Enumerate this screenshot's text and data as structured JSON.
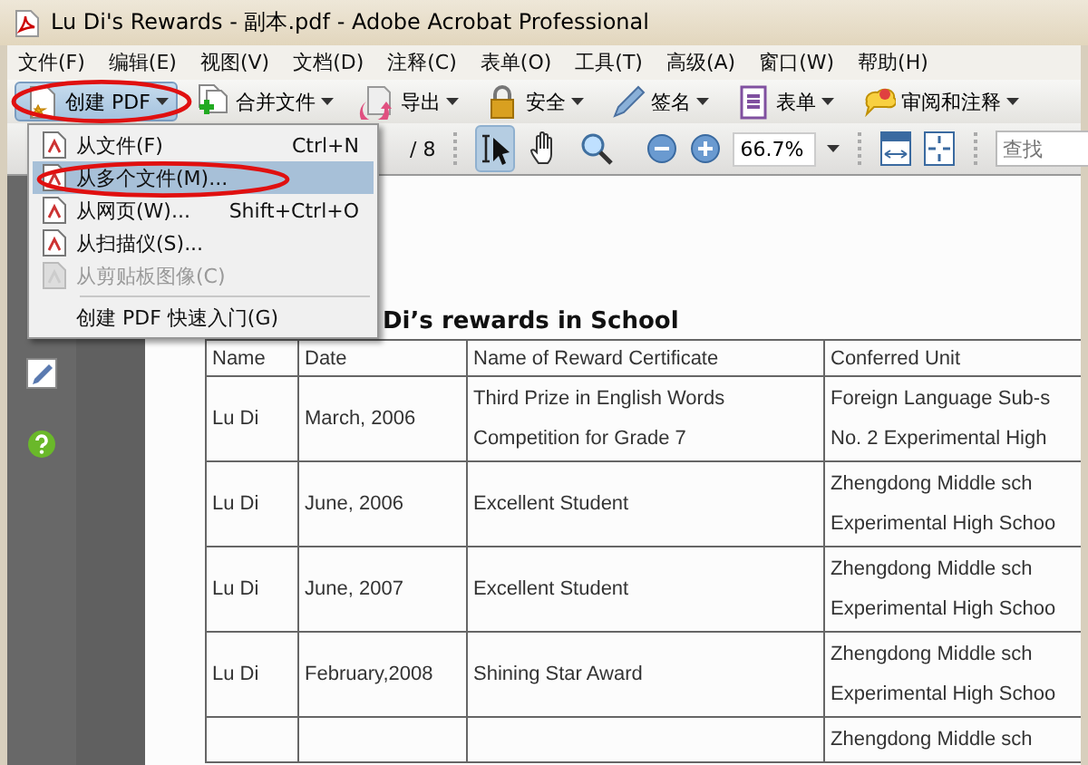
{
  "window": {
    "title": "Lu Di's Rewards - 副本.pdf - Adobe Acrobat Professional"
  },
  "menu_bar": [
    "文件(F)",
    "编辑(E)",
    "视图(V)",
    "文档(D)",
    "注释(C)",
    "表单(O)",
    "工具(T)",
    "高级(A)",
    "窗口(W)",
    "帮助(H)"
  ],
  "toolbar": [
    {
      "label": "创建 PDF",
      "selected": true
    },
    {
      "label": "合并文件",
      "selected": false
    },
    {
      "label": "导出",
      "selected": false
    },
    {
      "label": "安全",
      "selected": false
    },
    {
      "label": "签名",
      "selected": false
    },
    {
      "label": "表单",
      "selected": false
    },
    {
      "label": "审阅和注释",
      "selected": false
    }
  ],
  "nav_toolbar": {
    "page_total": "/ 8",
    "tools": [
      {
        "selected": true
      },
      {
        "selected": false
      },
      {
        "selected": false
      }
    ],
    "zoom": "66.7%",
    "search": {
      "placeholder": "查找"
    }
  },
  "dropdown_menu": [
    {
      "label": "从文件(F)",
      "shortcut": "Ctrl+N",
      "selected": false,
      "disabled": false
    },
    {
      "label": "从多个文件(M)...",
      "selected": true,
      "disabled": false
    },
    {
      "label": "从网页(W)...",
      "shortcut": "Shift+Ctrl+O",
      "selected": false,
      "disabled": false
    },
    {
      "label": "从扫描仪(S)...",
      "selected": false,
      "disabled": false
    },
    {
      "label": "从剪贴板图像(C)",
      "selected": false,
      "disabled": true
    },
    {
      "label": "创建 PDF 快速入门(G)",
      "selected": false,
      "disabled": false,
      "separator_before": true
    }
  ],
  "document": {
    "title": "Di’s rewards in School",
    "table": {
      "columns": [
        "Name",
        "Date",
        "Name of Reward Certificate",
        "Conferred Unit"
      ],
      "rows": [
        [
          "Lu Di",
          "March, 2006",
          "Third Prize in English Words Competition for Grade 7",
          "Foreign Language Sub-s\nNo. 2 Experimental High"
        ],
        [
          "Lu Di",
          "June, 2006",
          "Excellent Student",
          "Zhengdong Middle sch\nExperimental High Schoo"
        ],
        [
          "Lu Di",
          "June, 2007",
          "Excellent Student",
          "Zhengdong Middle sch\nExperimental High Schoo"
        ],
        [
          "Lu Di",
          "February,2008",
          "Shining Star Award",
          "Zhengdong Middle sch\nExperimental High Schoo"
        ],
        [
          "",
          "",
          "",
          "Zhengdong Middle sch"
        ]
      ]
    }
  }
}
